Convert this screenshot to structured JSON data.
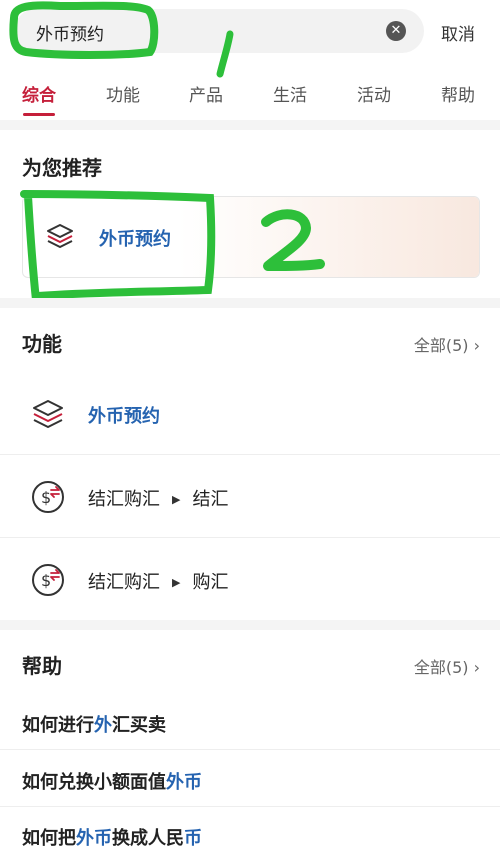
{
  "search": {
    "query": "外币预约",
    "clear_icon": "clear-circle-icon",
    "cancel_label": "取消"
  },
  "tabs": [
    {
      "label": "综合",
      "active": true
    },
    {
      "label": "功能",
      "active": false
    },
    {
      "label": "产品",
      "active": false
    },
    {
      "label": "生活",
      "active": false
    },
    {
      "label": "活动",
      "active": false
    },
    {
      "label": "帮助",
      "active": false
    }
  ],
  "recommend": {
    "title": "为您推荐",
    "item_label": "外币预约",
    "item_icon": "layers-icon"
  },
  "annotations": {
    "mark1": "1",
    "mark2": "2",
    "color": "#2dbf3a"
  },
  "functions": {
    "title": "功能",
    "all_label": "全部(5)",
    "items": [
      {
        "label": "外币预约",
        "icon": "layers-icon"
      },
      {
        "label": "结汇购汇",
        "sub": "结汇",
        "icon": "currency-exchange-icon"
      },
      {
        "label": "结汇购汇",
        "sub": "购汇",
        "icon": "currency-exchange-icon"
      }
    ]
  },
  "help": {
    "title": "帮助",
    "all_label": "全部(5)",
    "items": [
      {
        "parts": [
          "如何进行",
          "外",
          "汇买卖"
        ]
      },
      {
        "parts": [
          "如何兑换小额面值",
          "外币",
          ""
        ]
      },
      {
        "parts": [
          "如何把",
          "外币",
          "换成人民",
          "币"
        ]
      }
    ]
  },
  "colors": {
    "accent": "#c51f3a",
    "link_blue": "#2563b0"
  }
}
